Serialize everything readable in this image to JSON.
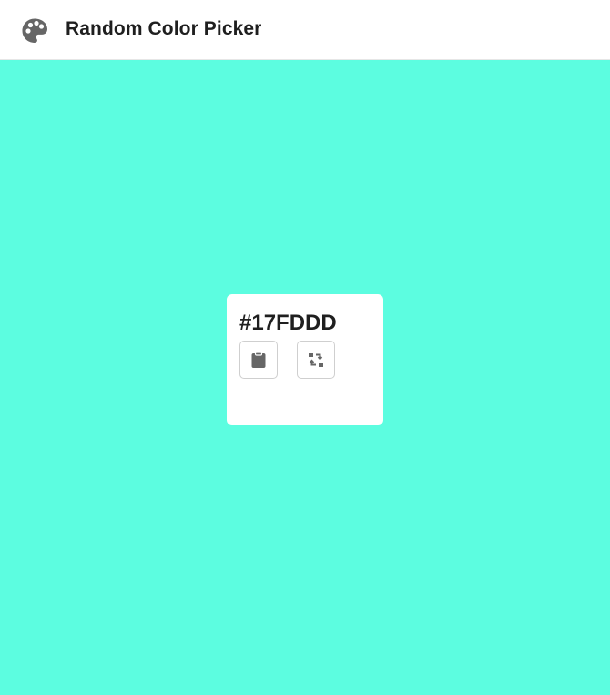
{
  "header": {
    "title": "Random Color Picker",
    "icon": "palette-icon"
  },
  "color": {
    "hex_label": "#17FDDD",
    "background": "#5cfde0"
  },
  "actions": {
    "copy_icon": "clipboard-icon",
    "refresh_icon": "swap-arrows-icon"
  },
  "colors": {
    "icon_gray": "#666666",
    "text": "#1f1f1f",
    "card": "#ffffff",
    "button_border": "#cfcfcf"
  }
}
